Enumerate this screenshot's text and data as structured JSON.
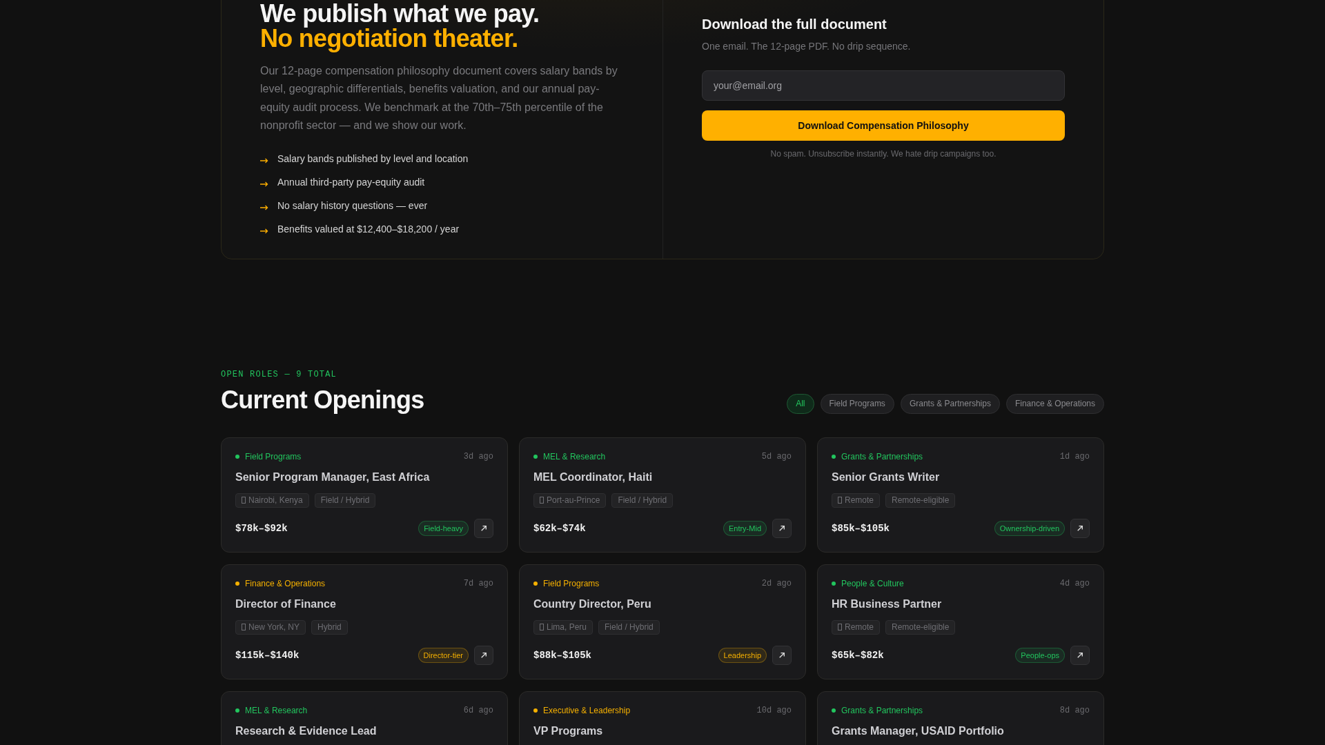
{
  "compensation": {
    "heading": "We publish what we pay.",
    "heading_accent": "No negotiation theater.",
    "body": "Our 12-page compensation philosophy document covers salary bands by level, geographic differentials, benefits valuation, and our annual pay-equity audit process. We benchmark at the 70th–75th percentile of the nonprofit sector — and we show our work.",
    "points": [
      "Salary bands published by level and location",
      "Annual third-party pay-equity audit",
      "No salary history questions — ever",
      "Benefits valued at $12,400–$18,200 / year"
    ],
    "download": {
      "title": "Download the full document",
      "subtitle": "One email. The 12-page PDF. No drip sequence.",
      "email": {
        "placeholder": "your@email.org"
      },
      "button": "Download Compensation Philosophy",
      "note": "No spam. Unsubscribe instantly. We hate drip campaigns too."
    }
  },
  "openings": {
    "eyebrow": "OPEN ROLES — 9 TOTAL",
    "title": "Current Openings",
    "filters": [
      {
        "label": "All",
        "selected": true
      },
      {
        "label": "Field Programs",
        "selected": false
      },
      {
        "label": "Grants & Partnerships",
        "selected": false
      },
      {
        "label": "Finance & Operations",
        "selected": false
      }
    ],
    "roles": [
      {
        "category": "Field Programs",
        "color": "#22c55e",
        "posted": "3d ago",
        "title": "Senior Program Manager, East Africa",
        "location": "Nairobi, Kenya",
        "mode": "Field / Hybrid",
        "salary": "$78k–$92k",
        "tier": "Field-heavy"
      },
      {
        "category": "MEL & Research",
        "color": "#22c55e",
        "posted": "5d ago",
        "title": "MEL Coordinator, Haiti",
        "location": "Port-au-Prince",
        "mode": "Field / Hybrid",
        "salary": "$62k–$74k",
        "tier": "Entry-Mid"
      },
      {
        "category": "Grants & Partnerships",
        "color": "#22c55e",
        "posted": "1d ago",
        "title": "Senior Grants Writer",
        "location": "Remote",
        "mode": "Remote-eligible",
        "salary": "$85k–$105k",
        "tier": "Ownership-driven"
      },
      {
        "category": "Finance & Operations",
        "color": "#f5b000",
        "posted": "7d ago",
        "title": "Director of Finance",
        "location": "New York, NY",
        "mode": "Hybrid",
        "salary": "$115k–$140k",
        "tier": "Director-tier"
      },
      {
        "category": "Field Programs",
        "color": "#f5b000",
        "posted": "2d ago",
        "title": "Country Director, Peru",
        "location": "Lima, Peru",
        "mode": "Field / Hybrid",
        "salary": "$88k–$105k",
        "tier": "Leadership"
      },
      {
        "category": "People & Culture",
        "color": "#22c55e",
        "posted": "4d ago",
        "title": "HR Business Partner",
        "location": "Remote",
        "mode": "Remote-eligible",
        "salary": "$65k–$82k",
        "tier": "People-ops"
      },
      {
        "category": "MEL & Research",
        "color": "#22c55e",
        "posted": "6d ago",
        "title": "Research & Evidence Lead"
      },
      {
        "category": "Executive & Leadership",
        "color": "#f5b000",
        "posted": "10d ago",
        "title": "VP Programs"
      },
      {
        "category": "Grants & Partnerships",
        "color": "#22c55e",
        "posted": "8d ago",
        "title": "Grants Manager, USAID Portfolio"
      }
    ]
  }
}
